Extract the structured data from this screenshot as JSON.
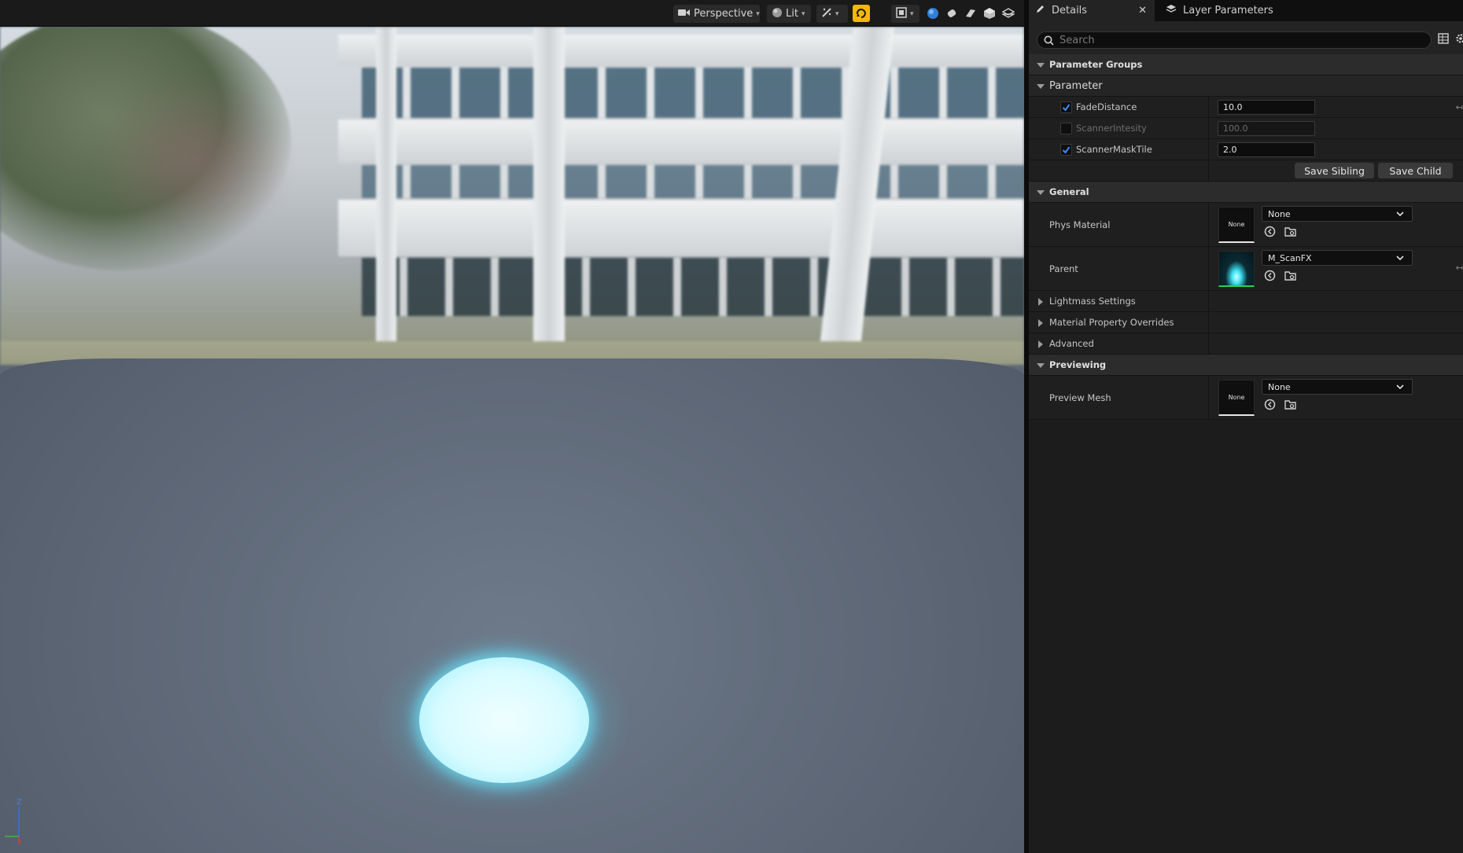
{
  "viewport": {
    "view_mode": "Perspective",
    "lighting_mode": "Lit",
    "axis": {
      "z": "Z",
      "x": "X"
    },
    "colors": {
      "glow": "#d8fbff",
      "highlight": "#f5b800"
    }
  },
  "details": {
    "tabs": [
      {
        "label": "Details",
        "icon": "pencil-icon",
        "closable": true
      },
      {
        "label": "Layer Parameters",
        "icon": "layers-icon"
      }
    ],
    "search": {
      "placeholder": "Search"
    },
    "sections": {
      "parameter_groups": "Parameter Groups",
      "parameter": "Parameter",
      "general": "General",
      "lightmass": "Lightmass Settings",
      "material_overrides": "Material Property Overrides",
      "advanced": "Advanced",
      "previewing": "Previewing"
    },
    "parameters": [
      {
        "name": "FadeDistance",
        "value": "10.0",
        "enabled": true
      },
      {
        "name": "ScannerIntesity",
        "value": "100.0",
        "enabled": false
      },
      {
        "name": "ScannerMaskTile",
        "value": "2.0",
        "enabled": true
      }
    ],
    "buttons": {
      "save_sibling": "Save Sibling",
      "save_child": "Save Child"
    },
    "general": {
      "phys_material": {
        "label": "Phys Material",
        "thumb": "None",
        "value": "None"
      },
      "parent": {
        "label": "Parent",
        "value": "M_ScanFX"
      }
    },
    "previewing": {
      "preview_mesh": {
        "label": "Preview Mesh",
        "thumb": "None",
        "value": "None"
      }
    }
  }
}
